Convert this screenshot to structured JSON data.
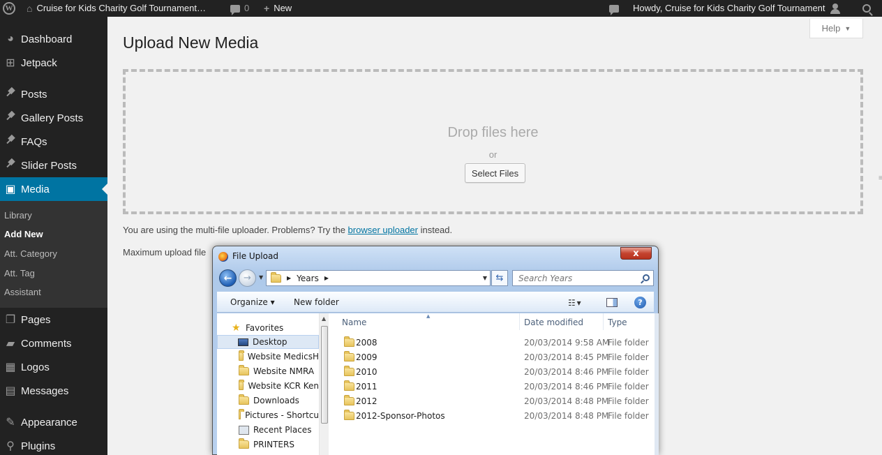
{
  "adminbar": {
    "site_title": "Cruise for Kids Charity Golf Tournament…",
    "comments_count": "0",
    "new_label": "New",
    "howdy": "Howdy, Cruise for Kids Charity Golf Tournament"
  },
  "sidebar": {
    "items": [
      {
        "label": "Dashboard",
        "icon": "dashboard-icon"
      },
      {
        "label": "Jetpack",
        "icon": "jetpack-icon"
      },
      {
        "label": "Posts",
        "icon": "pin-icon"
      },
      {
        "label": "Gallery Posts",
        "icon": "pin-icon"
      },
      {
        "label": "FAQs",
        "icon": "pin-icon"
      },
      {
        "label": "Slider Posts",
        "icon": "pin-icon"
      },
      {
        "label": "Media",
        "icon": "media-icon"
      },
      {
        "label": "Pages",
        "icon": "pages-icon"
      },
      {
        "label": "Comments",
        "icon": "comments-icon"
      },
      {
        "label": "Logos",
        "icon": "logos-icon"
      },
      {
        "label": "Messages",
        "icon": "messages-icon"
      },
      {
        "label": "Appearance",
        "icon": "appearance-icon"
      },
      {
        "label": "Plugins",
        "icon": "plugins-icon"
      }
    ],
    "submenu": [
      "Library",
      "Add New",
      "Att. Category",
      "Att. Tag",
      "Assistant"
    ]
  },
  "main": {
    "help_label": "Help",
    "title": "Upload New Media",
    "drop_text": "Drop files here",
    "or_text": "or",
    "select_files": "Select Files",
    "note_before": "You are using the multi-file uploader. Problems? Try the ",
    "note_link": "browser uploader",
    "note_after": " instead.",
    "max_upload": "Maximum upload file"
  },
  "dialog": {
    "title": "File Upload",
    "close": "x",
    "address": "Years",
    "search_placeholder": "Search Years",
    "organize": "Organize ▾",
    "new_folder": "New folder",
    "nav_items": [
      {
        "label": "Favorites",
        "icon": "star-icon"
      },
      {
        "label": "Desktop",
        "icon": "desktop-icon"
      },
      {
        "label": "Website MedicsH",
        "icon": "folder-icon"
      },
      {
        "label": "Website NMRA",
        "icon": "folder-icon"
      },
      {
        "label": "Website KCR Ken",
        "icon": "folder-icon"
      },
      {
        "label": "Downloads",
        "icon": "downloads-icon"
      },
      {
        "label": "Pictures - Shortcu",
        "icon": "folder-icon"
      },
      {
        "label": "Recent Places",
        "icon": "recent-places-icon"
      },
      {
        "label": "PRINTERS",
        "icon": "folder-icon"
      }
    ],
    "columns": [
      "Name",
      "Date modified",
      "Type"
    ],
    "files": [
      {
        "name": "2008",
        "date": "20/03/2014 9:58 AM",
        "type": "File folder"
      },
      {
        "name": "2009",
        "date": "20/03/2014 8:45 PM",
        "type": "File folder"
      },
      {
        "name": "2010",
        "date": "20/03/2014 8:46 PM",
        "type": "File folder"
      },
      {
        "name": "2011",
        "date": "20/03/2014 8:46 PM",
        "type": "File folder"
      },
      {
        "name": "2012",
        "date": "20/03/2014 8:48 PM",
        "type": "File folder"
      },
      {
        "name": "2012-Sponsor-Photos",
        "date": "20/03/2014 8:48 PM",
        "type": "File folder"
      }
    ]
  },
  "colors": {
    "adminbar_bg": "#222222",
    "menu_current": "#0074a2",
    "link": "#0074a2"
  }
}
